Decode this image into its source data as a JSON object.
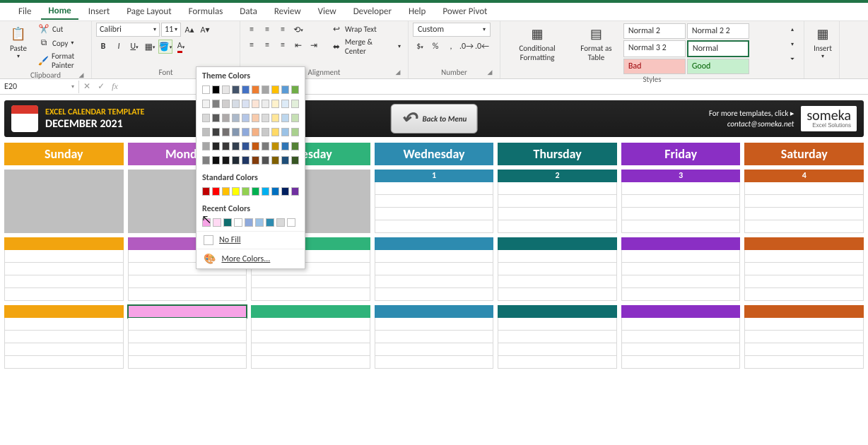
{
  "tabs": [
    "File",
    "Home",
    "Insert",
    "Page Layout",
    "Formulas",
    "Data",
    "Review",
    "View",
    "Developer",
    "Help",
    "Power Pivot"
  ],
  "activeTab": 1,
  "ribbon": {
    "clipboard": {
      "paste": "Paste",
      "cut": "Cut",
      "copy": "Copy",
      "format_painter": "Format Painter",
      "label": "Clipboard"
    },
    "font": {
      "name": "Calibri",
      "size": "11",
      "label": "Font"
    },
    "alignment": {
      "wrap": "Wrap Text",
      "merge": "Merge & Center",
      "label": "Alignment"
    },
    "number": {
      "format": "Custom",
      "label": "Number"
    },
    "styles": {
      "cond": "Conditional Formatting",
      "table": "Format as Table",
      "cells": [
        "Normal 2",
        "Normal 2 2",
        "Normal 3 2",
        "Normal",
        "Bad",
        "Good"
      ],
      "label": "Styles"
    },
    "cells_grp": {
      "insert": "Insert"
    }
  },
  "namebox": "E20",
  "banner": {
    "title": "EXCEL CALENDAR TEMPLATE",
    "month": "DECEMBER 2021",
    "back": "Back to Menu",
    "more": "For more templates, click ▸",
    "contact": "contact@someka.net",
    "logo": "someka",
    "logosub": "Excel Solutions"
  },
  "days": [
    "Sunday",
    "Monday",
    "Tuesday",
    "Wednesday",
    "Thursday",
    "Friday",
    "Saturday"
  ],
  "week1_dates": [
    "",
    "",
    "",
    "1",
    "2",
    "3",
    "4"
  ],
  "filldd": {
    "theme": "Theme Colors",
    "theme_row1": [
      "#ffffff",
      "#000000",
      "#e7e6e6",
      "#44546a",
      "#4472c4",
      "#ed7d31",
      "#a5a5a5",
      "#ffc000",
      "#5b9bd5",
      "#70ad47"
    ],
    "theme_shades": [
      [
        "#f2f2f2",
        "#7f7f7f",
        "#d0cece",
        "#d6dce5",
        "#d9e1f2",
        "#fce4d6",
        "#ededed",
        "#fff2cc",
        "#ddebf7",
        "#e2efda"
      ],
      [
        "#d9d9d9",
        "#595959",
        "#aeaaaa",
        "#acb9ca",
        "#b4c6e7",
        "#f8cbad",
        "#dbdbdb",
        "#ffe699",
        "#bdd7ee",
        "#c6e0b4"
      ],
      [
        "#bfbfbf",
        "#404040",
        "#757171",
        "#8497b0",
        "#8ea9db",
        "#f4b084",
        "#c9c9c9",
        "#ffd966",
        "#9bc2e6",
        "#a9d08e"
      ],
      [
        "#a6a6a6",
        "#262626",
        "#3a3838",
        "#333f4f",
        "#305496",
        "#c65911",
        "#7b7b7b",
        "#bf8f00",
        "#2f75b5",
        "#548235"
      ],
      [
        "#808080",
        "#0d0d0d",
        "#161616",
        "#222b35",
        "#203764",
        "#833c0c",
        "#525252",
        "#806000",
        "#1f4e78",
        "#375623"
      ]
    ],
    "standard": "Standard Colors",
    "standard_colors": [
      "#c00000",
      "#ff0000",
      "#ffc000",
      "#ffff00",
      "#92d050",
      "#00b050",
      "#00b0f0",
      "#0070c0",
      "#002060",
      "#7030a0"
    ],
    "recent": "Recent Colors",
    "recent_colors": [
      "#f7a3e6",
      "#ffd9f3",
      "#0f6e6e",
      "#ffffff",
      "#8ea9db",
      "#9bc2e6",
      "#2d8bb0",
      "#d9d9d9",
      "#ffffff"
    ],
    "nofill": "No Fill",
    "more": "More Colors..."
  }
}
